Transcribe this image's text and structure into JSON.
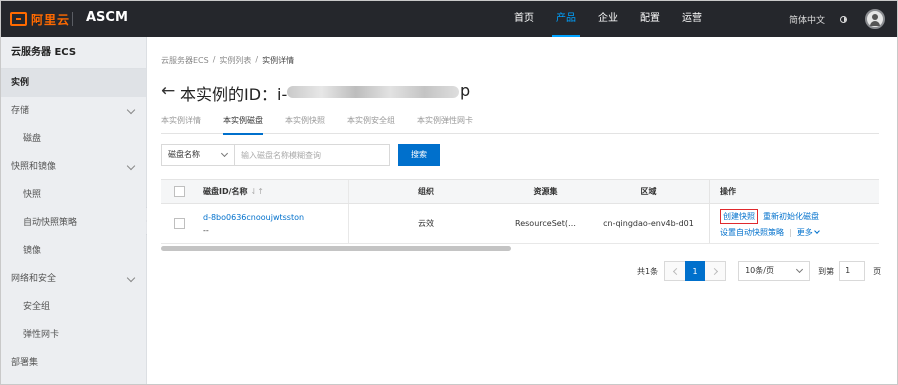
{
  "topbar": {
    "logo_text": "阿里云",
    "app_name": "ASCM",
    "nav": [
      {
        "label": "首页",
        "active": false
      },
      {
        "label": "产品",
        "active": true
      },
      {
        "label": "企业",
        "active": false
      },
      {
        "label": "配置",
        "active": false
      },
      {
        "label": "运营",
        "active": false
      }
    ],
    "language": "简体中文",
    "accent_color": "#00a2ff",
    "brand_color": "#ff6a00"
  },
  "sidebar": {
    "title": "云服务器 ECS",
    "items": [
      {
        "label": "实例",
        "level": 0,
        "active": true,
        "expandable": false
      },
      {
        "label": "存储",
        "level": 0,
        "active": false,
        "expandable": true
      },
      {
        "label": "磁盘",
        "level": 1,
        "active": false,
        "expandable": false
      },
      {
        "label": "快照和镜像",
        "level": 0,
        "active": false,
        "expandable": true
      },
      {
        "label": "快照",
        "level": 1,
        "active": false,
        "expandable": false
      },
      {
        "label": "自动快照策略",
        "level": 1,
        "active": false,
        "expandable": false
      },
      {
        "label": "镜像",
        "level": 1,
        "active": false,
        "expandable": false
      },
      {
        "label": "网络和安全",
        "level": 0,
        "active": false,
        "expandable": true
      },
      {
        "label": "安全组",
        "level": 1,
        "active": false,
        "expandable": false
      },
      {
        "label": "弹性网卡",
        "level": 1,
        "active": false,
        "expandable": false
      },
      {
        "label": "部署集",
        "level": 0,
        "active": false,
        "expandable": false
      }
    ]
  },
  "breadcrumb": [
    "云服务器ECS",
    "实例列表",
    "实例详情"
  ],
  "breadcrumb_sep": "/",
  "page": {
    "back_glyph": "←",
    "title": "本实例的ID：",
    "id_prefix": "i-",
    "id_suffix": "p"
  },
  "tabs": [
    {
      "label": "本实例详情",
      "active": false
    },
    {
      "label": "本实例磁盘",
      "active": true
    },
    {
      "label": "本实例快照",
      "active": false
    },
    {
      "label": "本实例安全组",
      "active": false
    },
    {
      "label": "本实例弹性网卡",
      "active": false
    }
  ],
  "filter": {
    "select_label": "磁盘名称",
    "input_placeholder": "输入磁盘名称模糊查询",
    "search_label": "搜索"
  },
  "table": {
    "columns": [
      "磁盘ID/名称",
      "组织",
      "资源集",
      "区域",
      "操作"
    ],
    "sort_glyph": "⇃↑",
    "rows": [
      {
        "id": "d-8bo0636cnooujwtsston",
        "name": "--",
        "org": "云效",
        "resource_set": "ResourceSet(…",
        "region": "cn-qingdao-env4b-d01",
        "actions": {
          "create_snapshot": "创建快照",
          "reinit_disk": "重新初始化磁盘",
          "set_auto_snapshot": "设置自动快照策略",
          "more": "更多",
          "sep": "|"
        }
      }
    ]
  },
  "pagination": {
    "total": "共1条",
    "current_page": "1",
    "page_size": "10条/页",
    "goto_label": "到第",
    "goto_value": "1",
    "page_label": "页"
  }
}
